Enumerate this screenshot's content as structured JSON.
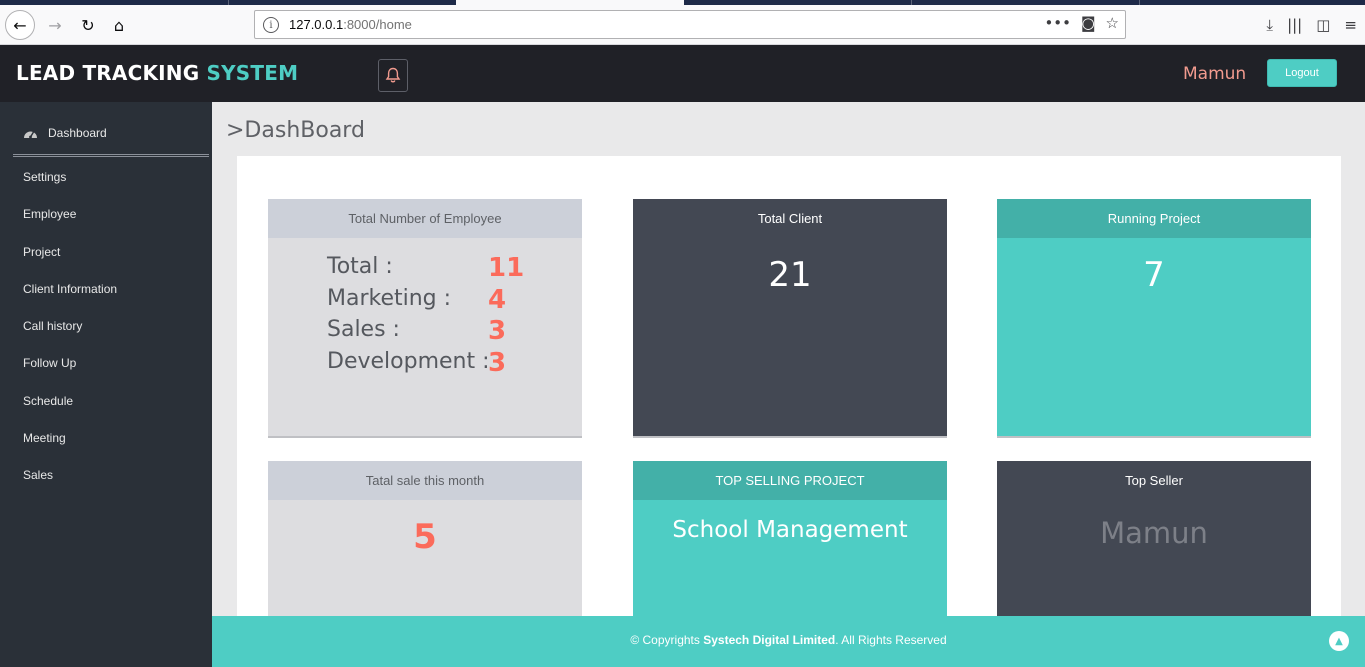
{
  "browser": {
    "url_host": "127.0.0.1",
    "url_path": ":8000/home"
  },
  "header": {
    "brand_part1": "LEAD TRACKING",
    "brand_part2": "SYSTEM",
    "username": "Mamun",
    "logout_label": "Logout"
  },
  "sidebar": {
    "dashboard_label": "Dashboard",
    "items": [
      {
        "label": "Settings"
      },
      {
        "label": "Employee"
      },
      {
        "label": "Project"
      },
      {
        "label": "Client Information"
      },
      {
        "label": "Call history"
      },
      {
        "label": "Follow Up"
      },
      {
        "label": "Schedule"
      },
      {
        "label": "Meeting"
      },
      {
        "label": "Sales"
      }
    ]
  },
  "main": {
    "title": ">DashBoard",
    "cards": {
      "employees": {
        "title": "Total Number of Employee",
        "rows": [
          {
            "label": "Total :",
            "value": "11"
          },
          {
            "label": "Marketing :",
            "value": "4"
          },
          {
            "label": "Sales :",
            "value": "3"
          },
          {
            "label": "Development :",
            "value": "3"
          }
        ]
      },
      "total_client": {
        "title": "Total Client",
        "value": "21"
      },
      "running_project": {
        "title": "Running Project",
        "value": "7"
      },
      "monthly_sale": {
        "title": "Tatal sale this month",
        "value": "5"
      },
      "top_project": {
        "title": "TOP SELLING PROJECT",
        "value": "School Management"
      },
      "top_seller": {
        "title": "Top Seller",
        "value": "Mamun"
      }
    }
  },
  "footer": {
    "prefix": "© Copyrights",
    "company": "Systech Digital Limited",
    "suffix": ". All Rights Reserved"
  },
  "colors": {
    "accent": "#4ecdc4",
    "dark": "#202127",
    "sidebar": "#2a3038",
    "card_dark": "#434853",
    "stat_red": "#fb6b5b",
    "username": "#f29b8f"
  }
}
